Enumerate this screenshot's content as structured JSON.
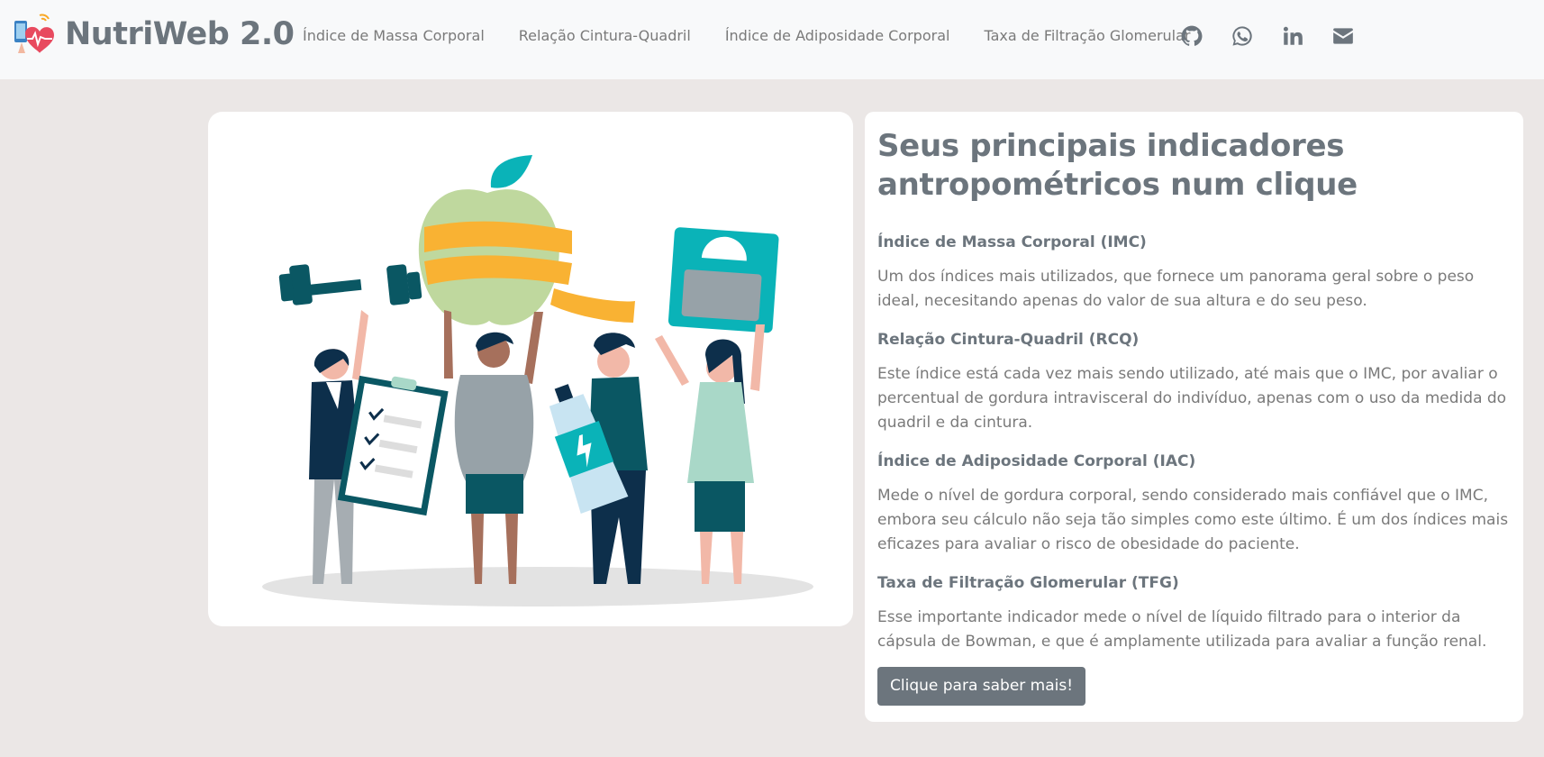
{
  "brand": {
    "name": "NutriWeb 2.0"
  },
  "nav": {
    "links": [
      "Índice de Massa Corporal",
      "Relação Cintura-Quadril",
      "Índice de Adiposidade Corporal",
      "Taxa de Filtração Glomerular"
    ],
    "icons": [
      "github-icon",
      "whatsapp-icon",
      "linkedin-icon",
      "envelope-icon"
    ]
  },
  "hero": {
    "title": "Seus principais indicadores antropométricos num clique"
  },
  "sections": [
    {
      "heading": "Índice de Massa Corporal (IMC)",
      "text": "Um dos índices mais utilizados, que fornece um panorama geral sobre o peso ideal, necesitando apenas do valor de sua altura e do seu peso."
    },
    {
      "heading": "Relação Cintura-Quadril (RCQ)",
      "text": "Este índice está cada vez mais sendo utilizado, até mais que o IMC, por avaliar o percentual de gordura intravisceral do indivíduo, apenas com o uso da medida do quadril e da cintura."
    },
    {
      "heading": "Índice de Adiposidade Corporal (IAC)",
      "text": "Mede o nível de gordura corporal, sendo considerado mais confiável que o IMC, embora seu cálculo não seja tão simples como este último. É um dos índices mais eficazes para avaliar o risco de obesidade do paciente."
    },
    {
      "heading": "Taxa de Filtração Glomerular (TFG)",
      "text": "Esse importante indicador mede o nível de líquido filtrado para o interior da cápsula de Bowman, e que é amplamente utilizada para avaliar a função renal."
    }
  ],
  "cta": {
    "label": "Clique para saber mais!"
  },
  "colors": {
    "page_bg": "#ebe7e6",
    "navbar_bg": "#f8f9fa",
    "text": "#6c757d",
    "button_bg": "#6c757d",
    "teal": "#0a5763",
    "apple_green": "#bfd89e",
    "tape_yellow": "#f9b233"
  }
}
